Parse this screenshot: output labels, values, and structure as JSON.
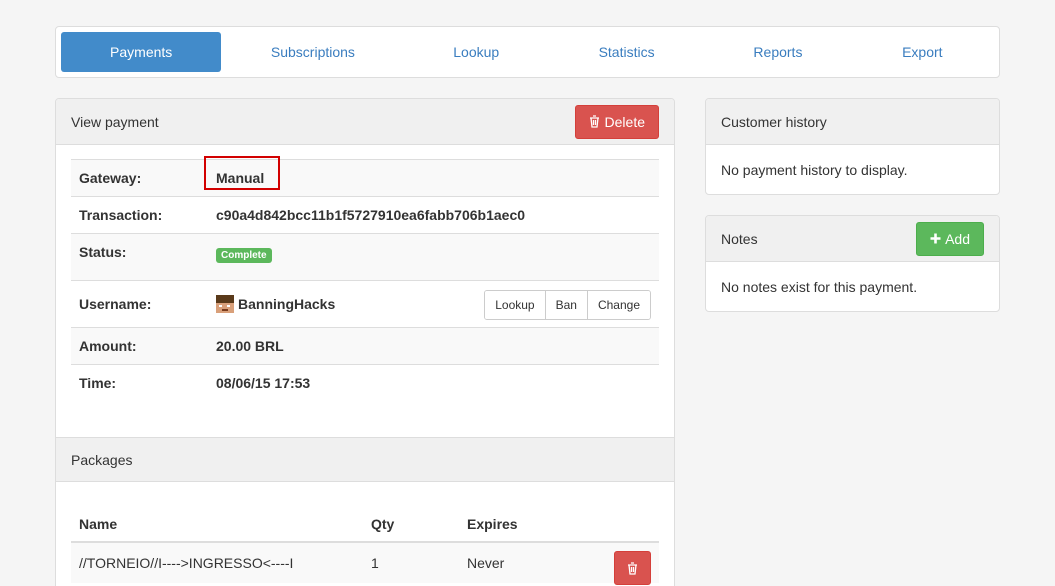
{
  "nav": {
    "tabs": [
      {
        "label": "Payments",
        "active": true
      },
      {
        "label": "Subscriptions"
      },
      {
        "label": "Lookup"
      },
      {
        "label": "Statistics"
      },
      {
        "label": "Reports"
      },
      {
        "label": "Export"
      }
    ]
  },
  "view_payment": {
    "title": "View payment",
    "delete_label": "Delete",
    "rows": {
      "gateway": {
        "label": "Gateway:",
        "value": "Manual"
      },
      "transaction": {
        "label": "Transaction:",
        "value": "c90a4d842bcc11b1f5727910ea6fabb706b1aec0"
      },
      "status": {
        "label": "Status:",
        "value": "Complete"
      },
      "username": {
        "label": "Username:",
        "value": "BanningHacks"
      },
      "amount": {
        "label": "Amount:",
        "value": "20.00 BRL"
      },
      "time": {
        "label": "Time:",
        "value": "08/06/15 17:53"
      }
    },
    "user_actions": {
      "lookup": "Lookup",
      "ban": "Ban",
      "change": "Change"
    }
  },
  "packages": {
    "title": "Packages",
    "columns": {
      "name": "Name",
      "qty": "Qty",
      "expires": "Expires"
    },
    "rows": [
      {
        "name": "//TORNEIO//I---->INGRESSO<----I",
        "qty": "1",
        "expires": "Never"
      }
    ]
  },
  "customer_history": {
    "title": "Customer history",
    "empty_text": "No payment history to display."
  },
  "notes": {
    "title": "Notes",
    "add_label": "Add",
    "empty_text": "No notes exist for this payment."
  },
  "colors": {
    "primary": "#428bca",
    "danger": "#d9534f",
    "success": "#5cb85c",
    "highlight": "#d20000"
  }
}
